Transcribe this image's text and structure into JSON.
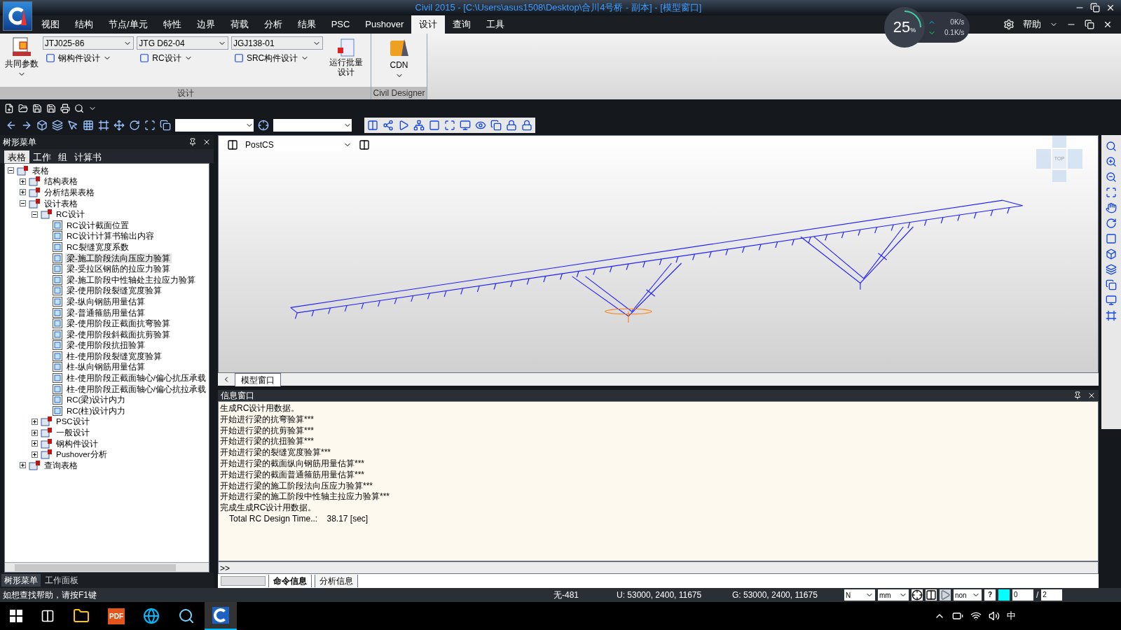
{
  "window": {
    "title": "Civil 2015 - [C:\\Users\\asus1508\\Desktop\\合川4号桥 - 副本] - [模型窗口]"
  },
  "menu": [
    {
      "label": "视图",
      "selected": false
    },
    {
      "label": "结构",
      "selected": false
    },
    {
      "label": "节点/单元",
      "selected": false
    },
    {
      "label": "特性",
      "selected": false
    },
    {
      "label": "边界",
      "selected": false
    },
    {
      "label": "荷载",
      "selected": false
    },
    {
      "label": "分析",
      "selected": false
    },
    {
      "label": "结果",
      "selected": false
    },
    {
      "label": "PSC",
      "selected": false
    },
    {
      "label": "Pushover",
      "selected": false
    },
    {
      "label": "设计",
      "selected": true
    },
    {
      "label": "查询",
      "selected": false
    },
    {
      "label": "工具",
      "selected": false
    }
  ],
  "network_meter": {
    "percent": "25",
    "unit": "%",
    "level": 0.25,
    "upload": "0K/s",
    "download": "0.1K/s"
  },
  "help": {
    "label": "帮助"
  },
  "ribbon": {
    "groups": [
      {
        "label": "设计",
        "common_button": "共同参数",
        "codes": [
          {
            "value": "JTJ025-86",
            "button": "钢构件设计"
          },
          {
            "value": "JTG D62-04",
            "button": "RC设计"
          },
          {
            "value": "JGJ138-01",
            "button": "SRC构件设计"
          }
        ],
        "batch_button": [
          "运行批量",
          "设计"
        ]
      },
      {
        "label": "Civil Designer",
        "button": "CDN"
      }
    ]
  },
  "tree_panel": {
    "title": "树形菜单",
    "tabs": [
      {
        "label": "表格",
        "selected": true
      },
      {
        "label": "工作",
        "selected": false
      },
      {
        "label": "组",
        "selected": false
      },
      {
        "label": "计算书",
        "selected": false
      }
    ],
    "tree": [
      {
        "label": "表格",
        "expanded": true,
        "selected": false,
        "children": [
          {
            "label": "结构表格",
            "expanded": false,
            "selected": false
          },
          {
            "label": "分析结果表格",
            "expanded": false,
            "selected": false
          },
          {
            "label": "设计表格",
            "expanded": true,
            "selected": false,
            "children": [
              {
                "label": "RC设计",
                "expanded": true,
                "selected": false,
                "children": [
                  {
                    "label": "RC设计截面位置",
                    "selected": false
                  },
                  {
                    "label": "RC设计计算书输出内容",
                    "selected": false
                  },
                  {
                    "label": "RC裂缝宽度系数",
                    "selected": false
                  },
                  {
                    "label": "梁-施工阶段法向压应力验算",
                    "selected": true
                  },
                  {
                    "label": "梁-受拉区钢筋的拉应力验算",
                    "selected": false
                  },
                  {
                    "label": "梁-施工阶段中性轴处主拉应力验算",
                    "selected": false
                  },
                  {
                    "label": "梁-使用阶段裂缝宽度验算",
                    "selected": false
                  },
                  {
                    "label": "梁-纵向钢筋用量估算",
                    "selected": false
                  },
                  {
                    "label": "梁-普通箍筋用量估算",
                    "selected": false
                  },
                  {
                    "label": "梁-使用阶段正截面抗弯验算",
                    "selected": false
                  },
                  {
                    "label": "梁-使用阶段斜截面抗剪验算",
                    "selected": false
                  },
                  {
                    "label": "梁-使用阶段抗扭验算",
                    "selected": false
                  },
                  {
                    "label": "柱-使用阶段裂缝宽度验算",
                    "selected": false
                  },
                  {
                    "label": "柱-纵向钢筋用量估算",
                    "selected": false
                  },
                  {
                    "label": "柱-使用阶段正截面轴心/偏心抗压承载",
                    "selected": false
                  },
                  {
                    "label": "柱-使用阶段正截面轴心/偏心抗拉承载",
                    "selected": false
                  },
                  {
                    "label": "RC(梁)设计内力",
                    "selected": false
                  },
                  {
                    "label": "RC(柱)设计内力",
                    "selected": false
                  }
                ]
              },
              {
                "label": "PSC设计",
                "expanded": false,
                "selected": false
              },
              {
                "label": "一般设计",
                "expanded": false,
                "selected": false
              },
              {
                "label": "钢构件设计",
                "expanded": false,
                "selected": false
              },
              {
                "label": "Pushover分析",
                "expanded": false,
                "selected": false
              }
            ]
          },
          {
            "label": "查询表格",
            "expanded": false,
            "selected": false
          }
        ]
      }
    ],
    "bottom_tabs": [
      {
        "label": "树形菜单",
        "selected": true
      },
      {
        "label": "工作面板",
        "selected": false
      }
    ]
  },
  "model_view": {
    "coordinate_system": "PostCS",
    "nav_cube_face": "TOP",
    "tab": "模型窗口"
  },
  "info_window": {
    "title": "信息窗口",
    "lines": [
      "生成RC设计用数据。",
      "开始进行梁的抗弯验算***",
      "开始进行梁的抗剪验算***",
      "开始进行梁的抗扭验算***",
      "开始进行梁的裂缝宽度验算***",
      "开始进行梁的截面纵向钢筋用量估算***",
      "开始进行梁的截面普通箍筋用量估算***",
      "开始进行梁的施工阶段法向压应力验算***",
      "开始进行梁的施工阶段中性轴主拉应力验算***",
      "完成生成RC设计用数据。",
      "    Total RC Design Time..:    38.17 [sec]"
    ],
    "prompt": ">>",
    "tabs": [
      {
        "label": "命令信息",
        "selected": true
      },
      {
        "label": "分析信息",
        "selected": false
      }
    ]
  },
  "status_bar": {
    "hint": "如想查找帮助，请按F1键",
    "selection": "无-481",
    "user_coords": "U: 53000, 2400, 11675",
    "global_coords": "G: 53000, 2400, 11675",
    "force_unit": "N",
    "length_unit": "mm",
    "mode": "non",
    "help_label": "?",
    "step": "0",
    "separator": "/",
    "total": "2"
  },
  "taskbar": {
    "pdf_label": "PDF",
    "ime": "中"
  }
}
